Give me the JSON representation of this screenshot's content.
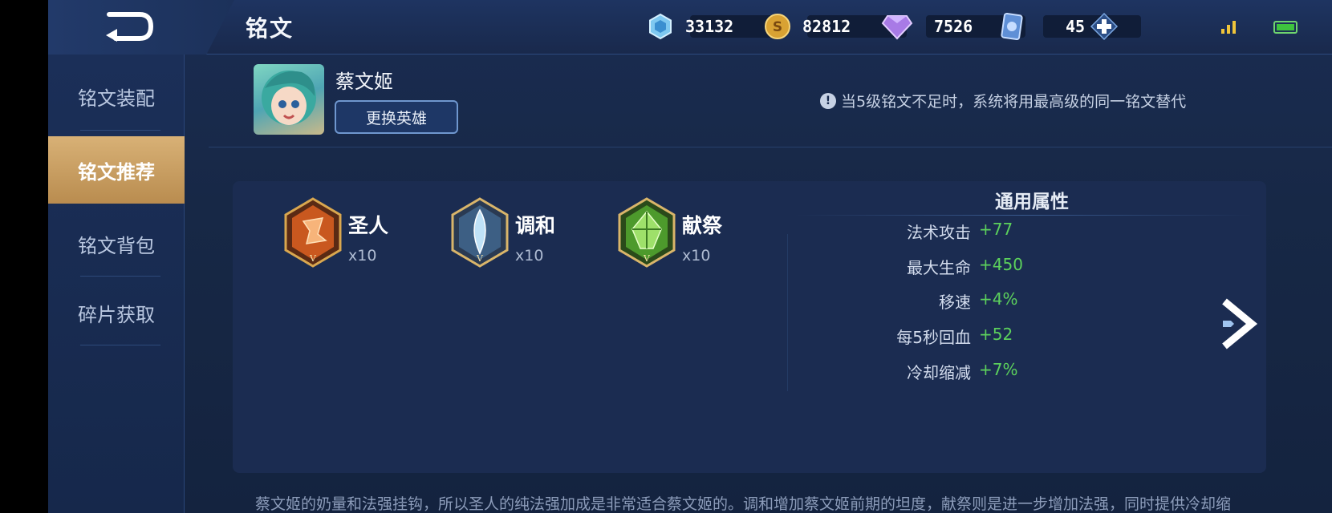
{
  "header": {
    "title": "铭文",
    "currencies": [
      {
        "icon": "hex-crystal-icon",
        "value": "33132"
      },
      {
        "icon": "gold-coin-icon",
        "value": "82812"
      },
      {
        "icon": "purple-diamond-icon",
        "value": "7526"
      },
      {
        "icon": "blue-card-icon",
        "value": "45"
      }
    ]
  },
  "sidebar": {
    "items": [
      {
        "label": "铭文装配",
        "active": false
      },
      {
        "label": "铭文推荐",
        "active": true
      },
      {
        "label": "铭文背包",
        "active": false
      },
      {
        "label": "碎片获取",
        "active": false
      }
    ]
  },
  "hero": {
    "name": "蔡文姬",
    "change_label": "更换英雄"
  },
  "notice": "当5级铭文不足时，系统将用最高级的同一铭文替代",
  "runes": [
    {
      "name": "圣人",
      "count": "x10",
      "level": "V",
      "color": "#e07a3a"
    },
    {
      "name": "调和",
      "count": "x10",
      "level": "V",
      "color": "#9cc6e8"
    },
    {
      "name": "献祭",
      "count": "x10",
      "level": "V",
      "color": "#6ac04a"
    }
  ],
  "attributes": {
    "title": "通用属性",
    "rows": [
      {
        "name": "法术攻击",
        "value": "+77"
      },
      {
        "name": "最大生命",
        "value": "+450"
      },
      {
        "name": "移速",
        "value": "+4%"
      },
      {
        "name": "每5秒回血",
        "value": "+52"
      },
      {
        "name": "冷却缩减",
        "value": "+7%"
      }
    ]
  },
  "description": "蔡文姬的奶量和法强挂钩，所以圣人的纯法强加成是非常适合蔡文姬的。调和增加蔡文姬前期的坦度，献祭则是进一步增加法强，同时提供冷却缩",
  "colors": {
    "accent_gold": "#d8b176",
    "positive_green": "#5cd15c",
    "background": "#172846"
  }
}
